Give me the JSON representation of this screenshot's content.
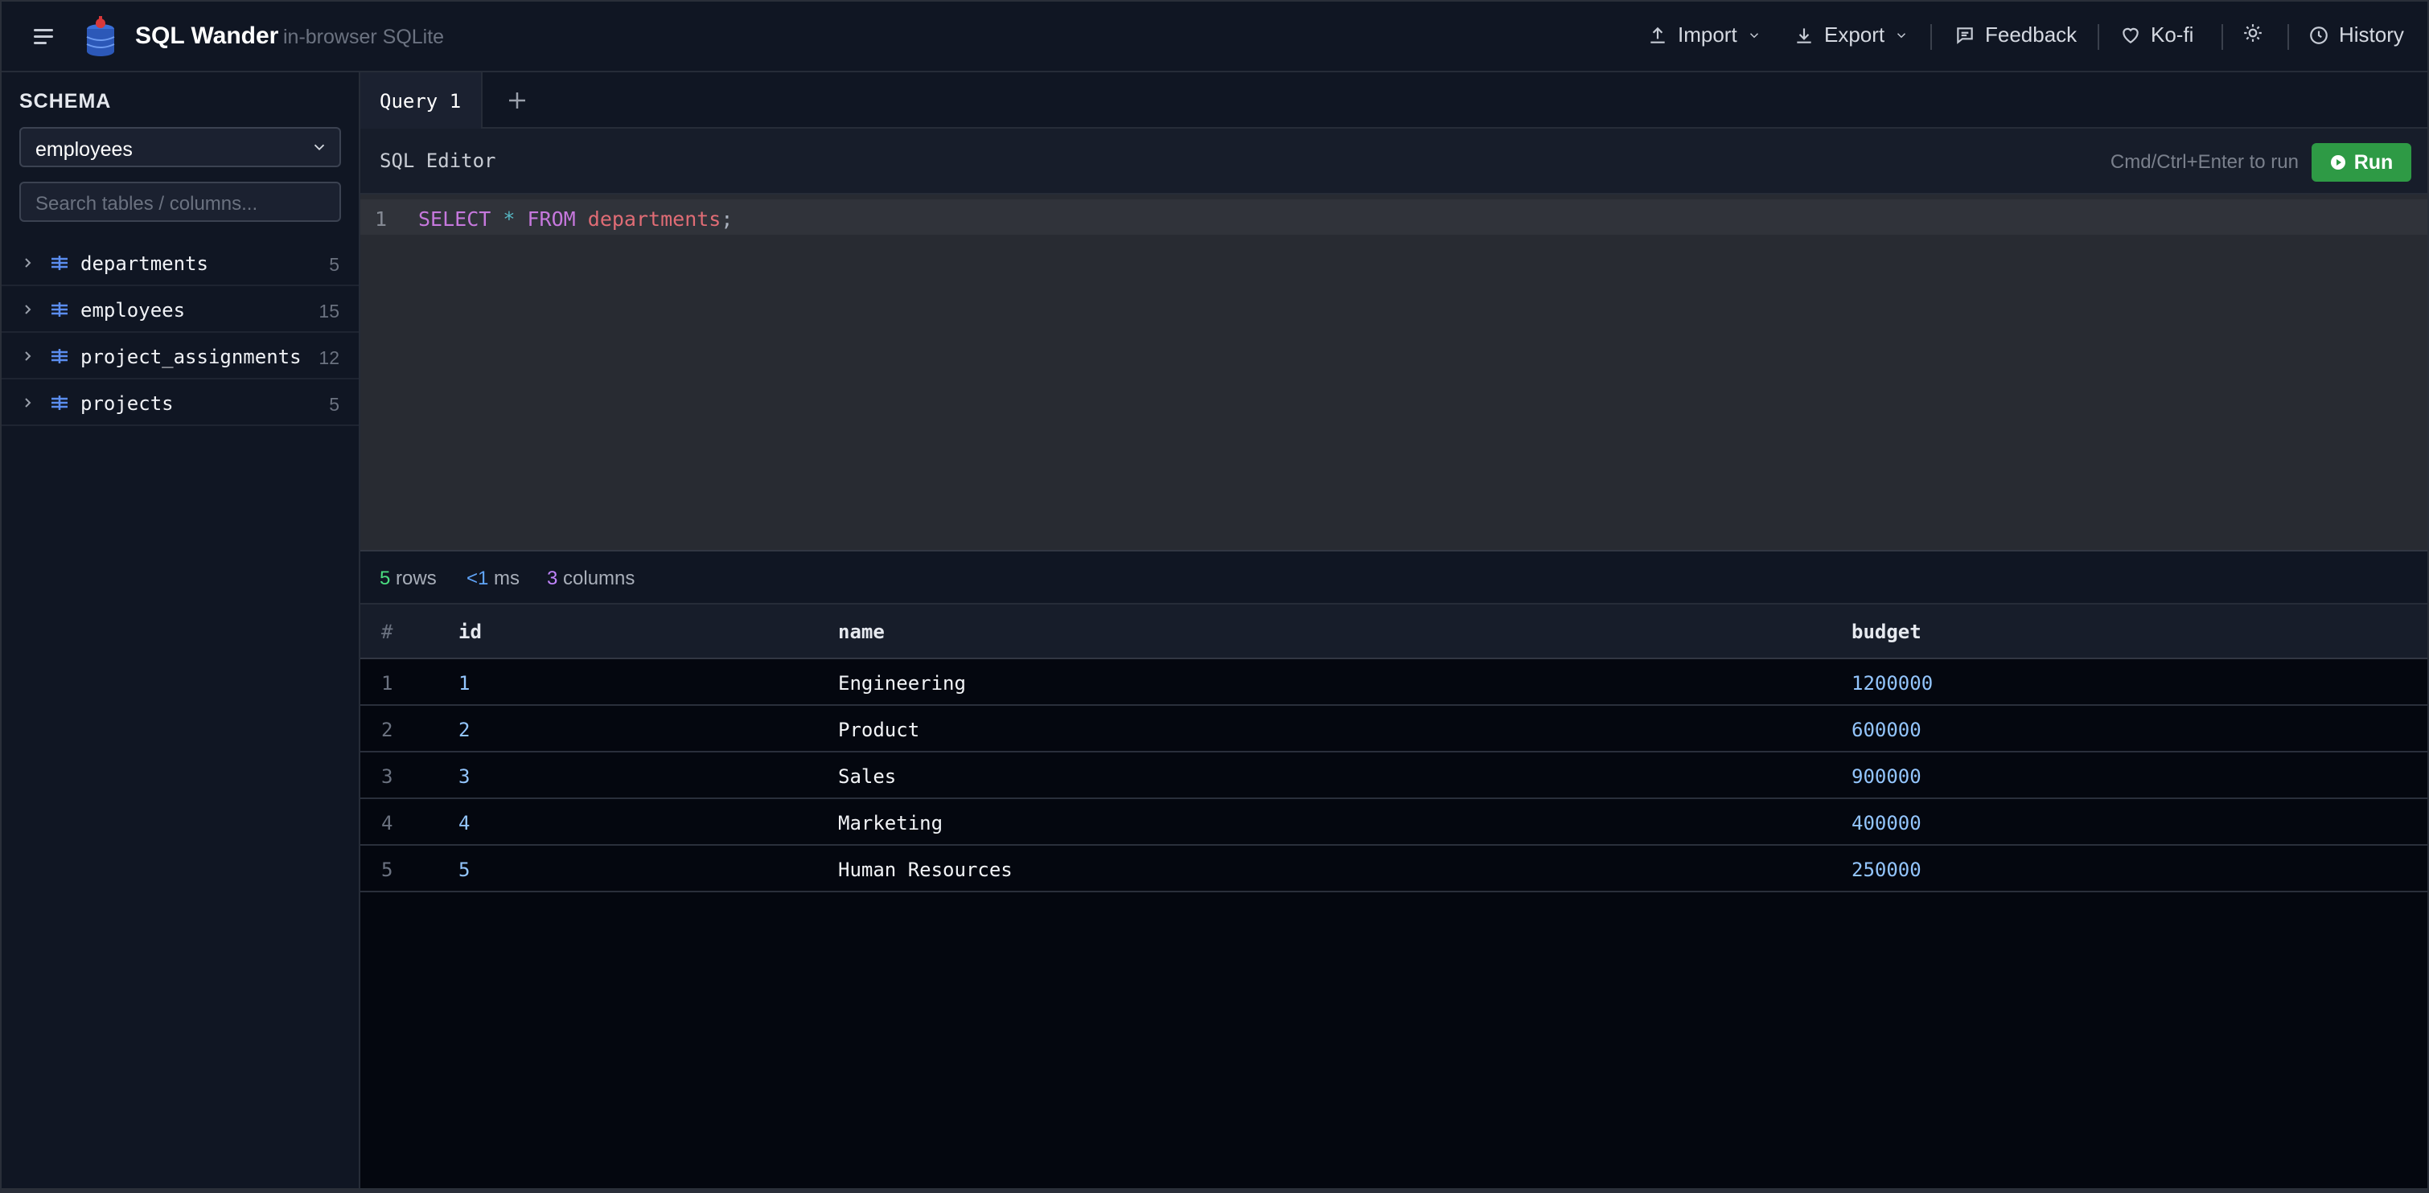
{
  "header": {
    "title": "SQL Wander",
    "subtitle": "in-browser SQLite",
    "import_label": "Import",
    "export_label": "Export",
    "feedback_label": "Feedback",
    "kofi_label": "Ko-fi",
    "history_label": "History"
  },
  "sidebar": {
    "schema_label": "SCHEMA",
    "database": "employees",
    "search_placeholder": "Search tables / columns...",
    "tables": [
      {
        "name": "departments",
        "count": "5"
      },
      {
        "name": "employees",
        "count": "15"
      },
      {
        "name": "project_assignments",
        "count": "12"
      },
      {
        "name": "projects",
        "count": "5"
      }
    ]
  },
  "tabs": [
    {
      "label": "Query 1"
    }
  ],
  "editor": {
    "label": "SQL Editor",
    "run_hint": "Cmd/Ctrl+Enter to run",
    "run_label": "Run",
    "line_number": "1",
    "tokens": {
      "select": "SELECT",
      "star": "*",
      "from": "FROM",
      "table": "departments",
      "semicolon": ";"
    }
  },
  "results": {
    "rows_count": "5",
    "rows_label": "rows",
    "time_value": "<1",
    "time_unit": "ms",
    "columns_count": "3",
    "columns_label": "columns",
    "headers": {
      "index": "#",
      "id": "id",
      "name": "name",
      "budget": "budget"
    },
    "rows": [
      {
        "idx": "1",
        "id": "1",
        "name": "Engineering",
        "budget": "1200000"
      },
      {
        "idx": "2",
        "id": "2",
        "name": "Product",
        "budget": "600000"
      },
      {
        "idx": "3",
        "id": "3",
        "name": "Sales",
        "budget": "900000"
      },
      {
        "idx": "4",
        "id": "4",
        "name": "Marketing",
        "budget": "400000"
      },
      {
        "idx": "5",
        "id": "5",
        "name": "Human Resources",
        "budget": "250000"
      }
    ]
  },
  "colors": {
    "accent_run": "#2e9a45",
    "keyword": "#c678dd",
    "identifier": "#e06c75",
    "number": "#93c5fd"
  }
}
